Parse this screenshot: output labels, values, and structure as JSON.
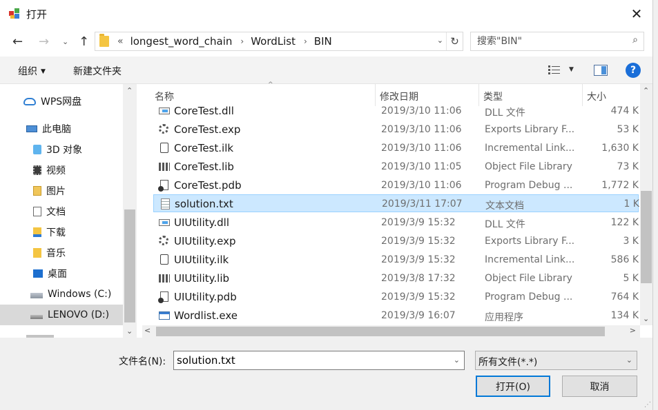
{
  "window": {
    "title": "打开",
    "close_glyph": "✕"
  },
  "address": {
    "back_glyph": "←",
    "forward_glyph": "→",
    "history_glyph": "⌄",
    "up_glyph": "↑",
    "overflow": "«",
    "crumbs": [
      "longest_word_chain",
      "WordList",
      "BIN"
    ],
    "separator": "›",
    "dropdown_glyph": "⌄",
    "refresh_glyph": "↻"
  },
  "search": {
    "placeholder": "搜索\"BIN\"",
    "icon_glyph": "⌕"
  },
  "toolbar": {
    "organize_label": "组织",
    "organize_caret": "▼",
    "new_folder_label": "新建文件夹",
    "view_caret": "▼",
    "help_glyph": "?"
  },
  "nav": {
    "items": [
      {
        "label": "WPS网盘",
        "icon": "cloud-icon"
      },
      {
        "label": "此电脑",
        "icon": "computer-icon"
      },
      {
        "label": "3D 对象",
        "icon": "3d-objects-icon"
      },
      {
        "label": "视频",
        "icon": "video-icon"
      },
      {
        "label": "图片",
        "icon": "pictures-icon"
      },
      {
        "label": "文档",
        "icon": "documents-icon"
      },
      {
        "label": "下载",
        "icon": "downloads-icon"
      },
      {
        "label": "音乐",
        "icon": "music-icon"
      },
      {
        "label": "桌面",
        "icon": "desktop-icon"
      },
      {
        "label": "Windows (C:)",
        "icon": "windows-drive-icon"
      },
      {
        "label": "LENOVO (D:)",
        "icon": "drive-icon",
        "selected": true
      }
    ],
    "scroll_up": "⌃",
    "scroll_down": "⌄"
  },
  "columns": {
    "name": "名称",
    "date": "修改日期",
    "type": "类型",
    "size": "大小",
    "sort_caret": "^"
  },
  "files": [
    {
      "name": "CoreTest.dll",
      "date": "2019/3/10 11:06",
      "type": "DLL 文件",
      "size": "474 K",
      "icon": "dll-icon"
    },
    {
      "name": "CoreTest.exp",
      "date": "2019/3/10 11:06",
      "type": "Exports Library F...",
      "size": "53 K",
      "icon": "exp-icon"
    },
    {
      "name": "CoreTest.ilk",
      "date": "2019/3/10 11:06",
      "type": "Incremental Link...",
      "size": "1,630 K",
      "icon": "ilk-icon"
    },
    {
      "name": "CoreTest.lib",
      "date": "2019/3/10 11:05",
      "type": "Object File Library",
      "size": "73 K",
      "icon": "lib-icon"
    },
    {
      "name": "CoreTest.pdb",
      "date": "2019/3/10 11:06",
      "type": "Program Debug ...",
      "size": "1,772 K",
      "icon": "pdb-icon"
    },
    {
      "name": "solution.txt",
      "date": "2019/3/11 17:07",
      "type": "文本文档",
      "size": "1 K",
      "icon": "text-file-icon",
      "selected": true
    },
    {
      "name": "UIUtility.dll",
      "date": "2019/3/9 15:32",
      "type": "DLL 文件",
      "size": "122 K",
      "icon": "dll-icon"
    },
    {
      "name": "UIUtility.exp",
      "date": "2019/3/9 15:32",
      "type": "Exports Library F...",
      "size": "3 K",
      "icon": "exp-icon"
    },
    {
      "name": "UIUtility.ilk",
      "date": "2019/3/9 15:32",
      "type": "Incremental Link...",
      "size": "586 K",
      "icon": "ilk-icon"
    },
    {
      "name": "UIUtility.lib",
      "date": "2019/3/8 17:32",
      "type": "Object File Library",
      "size": "5 K",
      "icon": "lib-icon"
    },
    {
      "name": "UIUtility.pdb",
      "date": "2019/3/9 15:32",
      "type": "Program Debug ...",
      "size": "764 K",
      "icon": "pdb-icon"
    },
    {
      "name": "Wordlist.exe",
      "date": "2019/3/9 16:07",
      "type": "应用程序",
      "size": "134 K",
      "icon": "exe-icon"
    }
  ],
  "scroll": {
    "up": "⌃",
    "down": "⌄",
    "left": "<",
    "right": ">"
  },
  "bottom": {
    "filename_label": "文件名(N):",
    "filename_value": "solution.txt",
    "filename_caret": "⌄",
    "filetype_value": "所有文件(*.*)",
    "filetype_caret": "⌄",
    "open_label": "打开(O)",
    "cancel_label": "取消"
  },
  "colors": {
    "selection_bg": "#cce8ff",
    "selection_border": "#99d1ff",
    "accent": "#0078d7"
  }
}
